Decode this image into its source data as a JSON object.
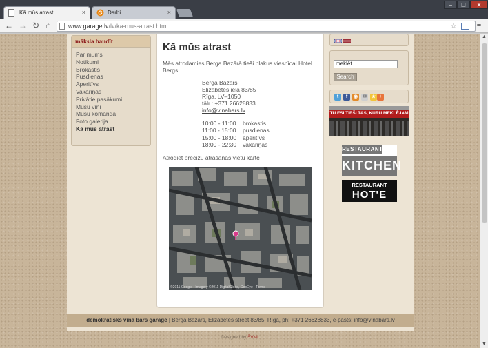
{
  "browser": {
    "tabs": [
      {
        "title": "Kā mūs atrast",
        "close": "×"
      },
      {
        "title": "Darbi",
        "close": "×"
      }
    ],
    "url_host": "www.garage.lv",
    "url_path": "/lv/ka-mus-atrast.html",
    "window_controls": {
      "minimize": "‒",
      "maximize": "□",
      "close": "✕"
    },
    "nav": {
      "back": "←",
      "forward": "→",
      "reload": "↻",
      "home": "⌂"
    }
  },
  "sidebar": {
    "heading": "māksla baudīt",
    "items": [
      {
        "label": "Par mums"
      },
      {
        "label": "Notikumi"
      },
      {
        "label": "Brokastis"
      },
      {
        "label": "Pusdienas"
      },
      {
        "label": "Aperitīvs"
      },
      {
        "label": "Vakariņas"
      },
      {
        "label": "Privātie pasākumi"
      },
      {
        "label": "Mūsu vīni"
      },
      {
        "label": "Mūsu komanda"
      },
      {
        "label": "Foto galerija"
      },
      {
        "label": "Kā mūs atrast",
        "current": true
      }
    ]
  },
  "content": {
    "title": "Kā mūs atrast",
    "intro": "Mēs atrodamies Berga Bazārā tieši blakus viesnīcai Hotel Bergs.",
    "address": [
      "Berga Bazārs",
      "Elizabetes iela 83/85",
      "Rīga, LV–1050",
      "tālr.: +371 26628833"
    ],
    "email": "info@vinabars.lv",
    "hours": [
      {
        "time": "10:00 - 11:00",
        "meal": "brokastis"
      },
      {
        "time": "11:00 - 15:00",
        "meal": "pusdienas"
      },
      {
        "time": "15:00 - 18:00",
        "meal": "aperitīvs"
      },
      {
        "time": "18:00 - 22:30",
        "meal": "vakariņas"
      }
    ],
    "map_text": "Atrodiet precīzu atrašanās vietu",
    "map_link": "kartē",
    "map_copyright": "©2011 Google · Imagery ©2011 DigitalGlobe, GeoEye · Terms"
  },
  "right": {
    "search_value": "meklēt...",
    "search_button": "Search",
    "banner_text": "TU ESI TIEŠI TAS, KURU MEKLĒJAM",
    "logo_kitchen_top": "RESTAURANT",
    "logo_kitchen_main": "KITCHEN",
    "logo_hote_top": "RESTAURANT",
    "logo_hote_main": "HOT'E"
  },
  "footer": {
    "brand": "demokrātisks vīna bārs garage",
    "text": " | Berga Bazārs, Elizabetes street 83/85, Rīga, ph: +371 26628833, e-pasts: info@vinabars.lv",
    "credit_prefix": "Designed by ",
    "credit_link": "ŠVMI"
  },
  "colors": {
    "accent": "#8c1a1a",
    "page_bg": "#c8b59a",
    "panel": "#ede4d4"
  }
}
